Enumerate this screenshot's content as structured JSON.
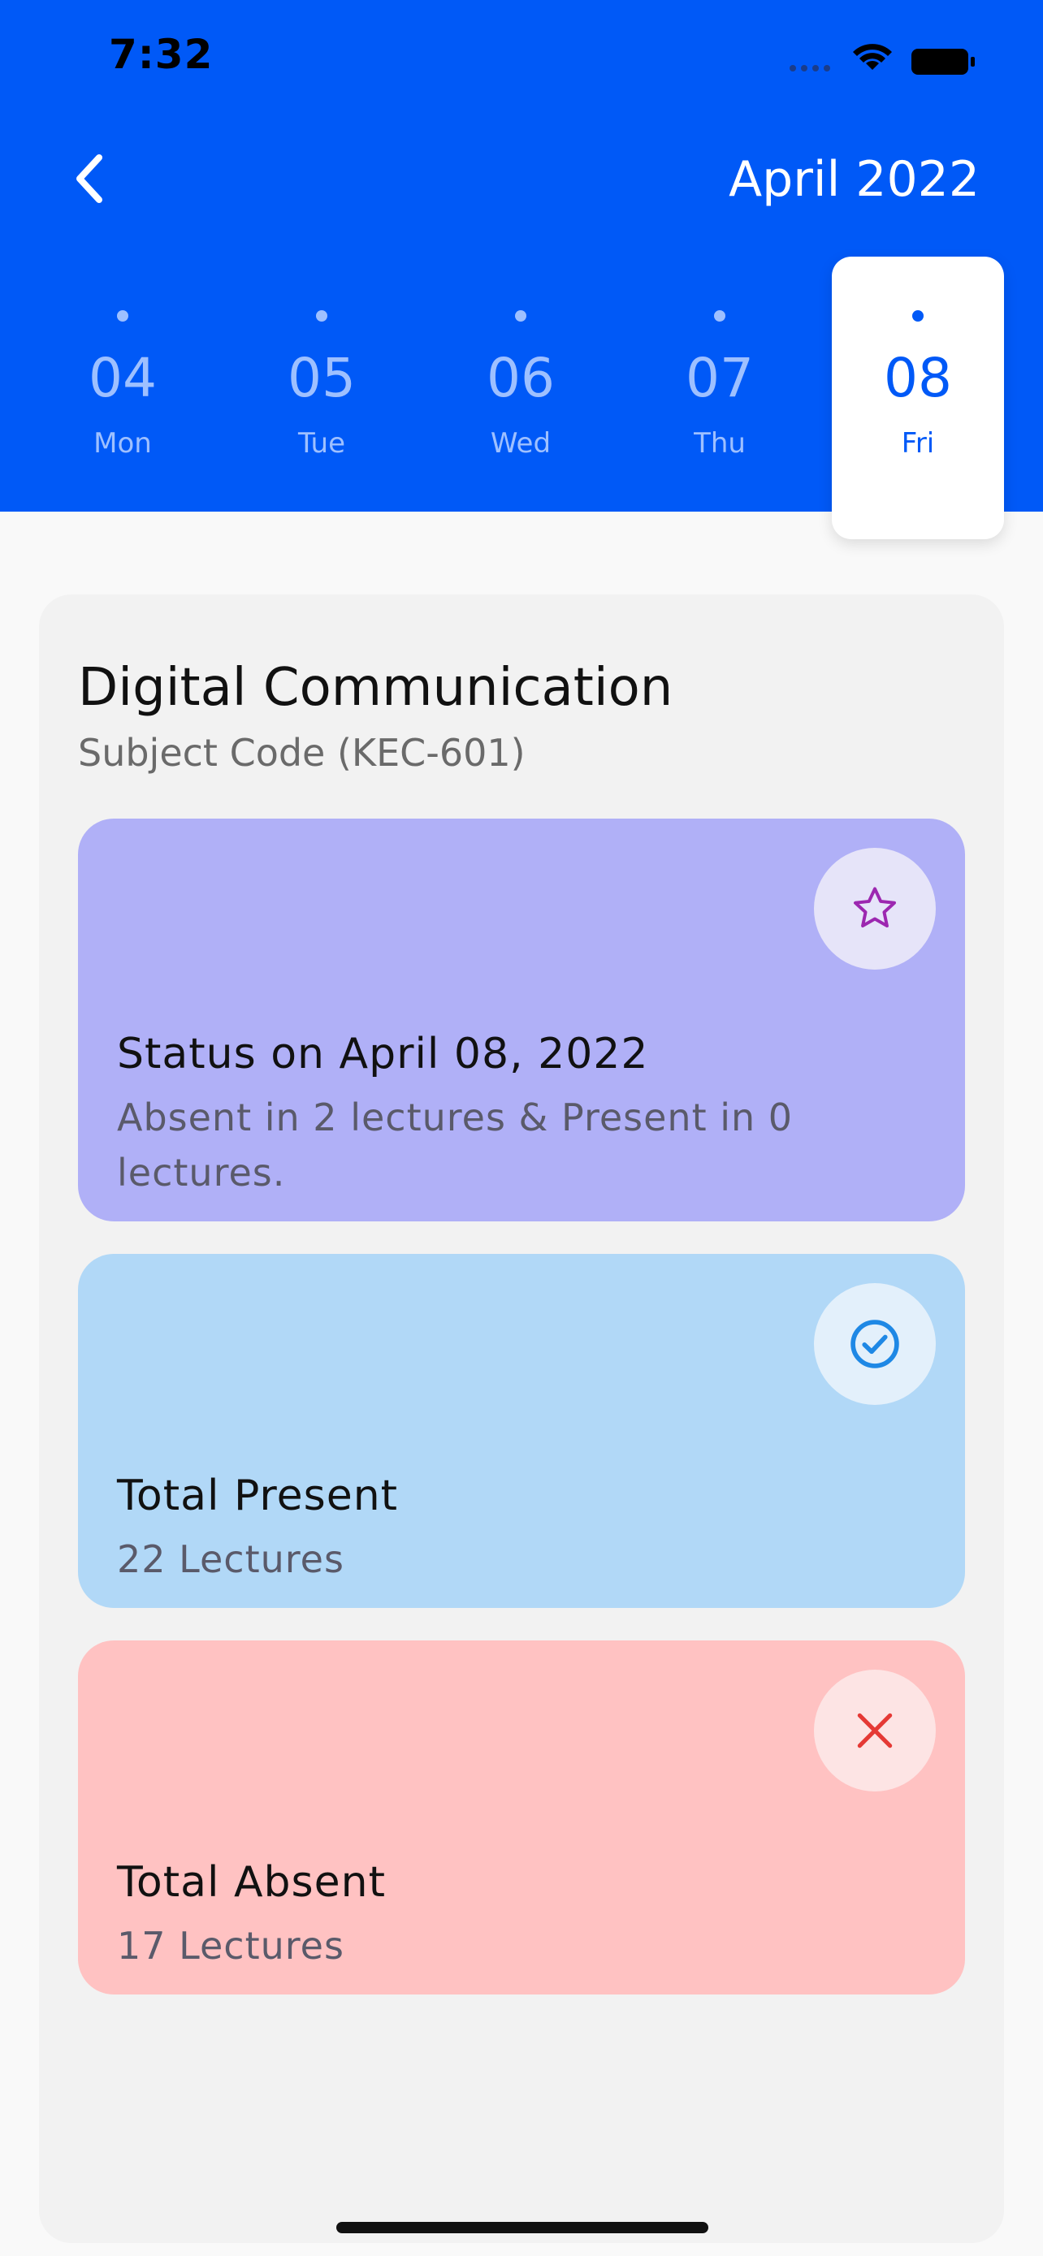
{
  "status_bar": {
    "time": "7:32"
  },
  "header": {
    "month": "April 2022",
    "days": [
      {
        "num": "04",
        "name": "Mon",
        "selected": false
      },
      {
        "num": "05",
        "name": "Tue",
        "selected": false
      },
      {
        "num": "06",
        "name": "Wed",
        "selected": false
      },
      {
        "num": "07",
        "name": "Thu",
        "selected": false
      },
      {
        "num": "08",
        "name": "Fri",
        "selected": true
      }
    ]
  },
  "subject": {
    "title": "Digital Communication",
    "code": "Subject Code (KEC-601)"
  },
  "cards": {
    "status": {
      "title": "Status on April 08, 2022",
      "subtitle": "Absent in 2 lectures & Present in 0 lectures.",
      "icon": "star-icon",
      "color": "#b0b0f7",
      "icon_color": "#9c27b0"
    },
    "present": {
      "title": "Total Present",
      "subtitle": "22 Lectures",
      "icon": "check-circle-icon",
      "color": "#b1d8f7",
      "icon_color": "#1e88e5"
    },
    "absent": {
      "title": "Total Absent",
      "subtitle": "17 Lectures",
      "icon": "close-icon",
      "color": "#ffc2c2",
      "icon_color": "#e53935"
    }
  },
  "colors": {
    "header_bg": "#0059f7",
    "selected_day_text": "#0059f7"
  }
}
